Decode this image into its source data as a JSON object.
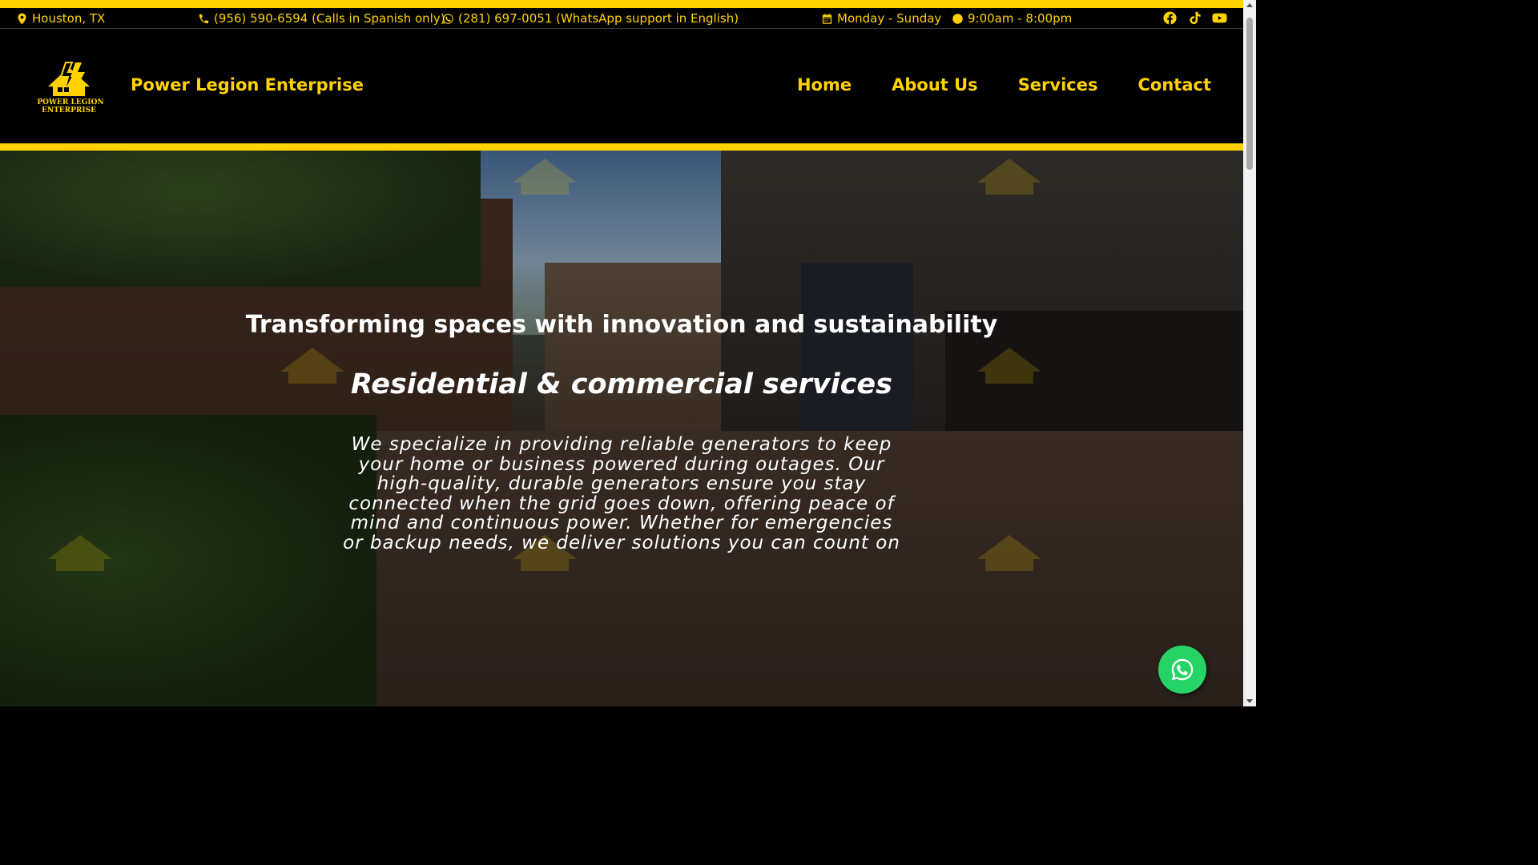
{
  "topbar": {
    "location": "Houston, TX",
    "phone_spanish": "(956) 590-6594 (Calls in Spanish only)",
    "whatsapp_english": "(281) 697-0051 (WhatsApp support in English)",
    "days": "Monday - Sunday",
    "hours": "9:00am - 8:00pm",
    "icons": [
      "map-marker-icon",
      "phone-icon",
      "whatsapp-icon",
      "calendar-icon",
      "clock-icon",
      "facebook-icon",
      "tiktok-icon",
      "youtube-icon"
    ]
  },
  "header": {
    "logo_text_line1": "POWER LEGION",
    "logo_text_line2": "ENTERPRISE",
    "brand_name": "Power Legion Enterprise",
    "nav": [
      "Home",
      "About Us",
      "Services",
      "Contact"
    ]
  },
  "hero": {
    "title": "Transforming spaces with innovation and sustainability",
    "subtitle": "Residential & commercial services",
    "description": "We specialize in providing reliable generators to keep your home or business powered during outages. Our high-quality, durable generators ensure you stay connected when the grid goes down, offering peace of mind and continuous power. Whether for emergencies or backup needs, we deliver solutions you can count on"
  },
  "colors": {
    "accent": "#ffd200",
    "background": "#000000",
    "whatsapp": "#25d366"
  }
}
